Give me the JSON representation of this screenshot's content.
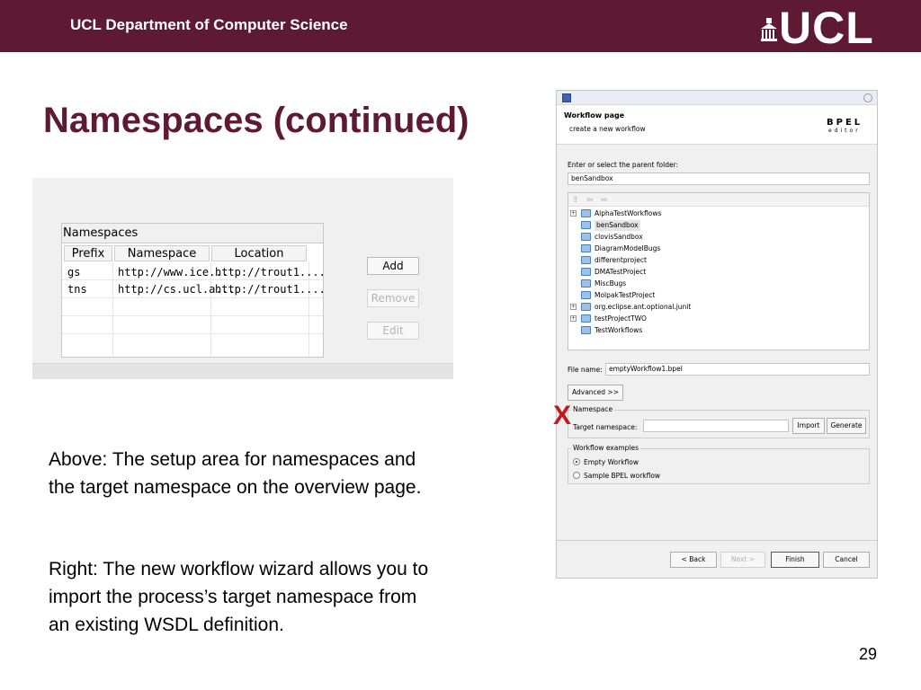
{
  "header": {
    "department": "UCL Department of Computer Science",
    "logo_text": "UCL",
    "background_color": "#5e1a32"
  },
  "slide": {
    "title": "Namespaces (continued)",
    "title_color": "#5e1a32",
    "page_number": "29",
    "paragraphs": [
      [
        "Above: The setup area for namespaces and",
        "the target namespace on the overview page."
      ],
      [
        "Right: The new workflow wizard allows you to",
        "import the process’s target namespace from",
        "an existing WSDL definition."
      ]
    ]
  },
  "namespaces_panel": {
    "group_label": "Namespaces",
    "columns": [
      "Prefix",
      "Namespace",
      "Location"
    ],
    "rows": [
      [
        "gs",
        "http://www.ice...",
        "http://trout1...."
      ],
      [
        "tns",
        "http://cs.ucl.a...",
        "http://trout1...."
      ]
    ],
    "buttons": {
      "add": "Add",
      "remove": "Remove",
      "edit": "Edit"
    }
  },
  "wizard": {
    "page_title": "Workflow page",
    "page_description": "create a new workflow",
    "logo_main": "BPEL",
    "logo_sub": "editor",
    "parent_folder_label": "Enter or select the parent folder:",
    "parent_folder_value": "benSandbox",
    "tree_items": [
      {
        "label": "AlphaTestWorkflows",
        "expandable": true,
        "selected": false
      },
      {
        "label": "benSandbox",
        "expandable": false,
        "selected": true
      },
      {
        "label": "clovisSandbox",
        "expandable": false,
        "selected": false
      },
      {
        "label": "DiagramModelBugs",
        "expandable": false,
        "selected": false
      },
      {
        "label": "differentproject",
        "expandable": false,
        "selected": false
      },
      {
        "label": "DMATestProject",
        "expandable": false,
        "selected": false
      },
      {
        "label": "MiscBugs",
        "expandable": false,
        "selected": false
      },
      {
        "label": "MolpakTestProject",
        "expandable": false,
        "selected": false
      },
      {
        "label": "org.eclipse.ant.optional.junit",
        "expandable": true,
        "selected": false
      },
      {
        "label": "testProjectTWO",
        "expandable": true,
        "selected": false
      },
      {
        "label": "TestWorkflows",
        "expandable": false,
        "selected": false
      }
    ],
    "file_name_label": "File name:",
    "file_name_value": "emptyWorkflow1.bpel",
    "advanced_button": "Advanced >>",
    "namespace_group": "Namespace",
    "target_namespace_label": "Target namespace:",
    "target_namespace_value": "",
    "import_button": "Import",
    "generate_button": "Generate",
    "examples_group": "Workflow examples",
    "examples": [
      {
        "label": "Empty Workflow",
        "selected": true
      },
      {
        "label": "Sample BPEL workflow",
        "selected": false
      }
    ],
    "nav_buttons": {
      "back": "< Back",
      "next": "Next >",
      "finish": "Finish",
      "cancel": "Cancel"
    }
  },
  "annotation": {
    "mark": "X",
    "color": "#c61a1a"
  }
}
